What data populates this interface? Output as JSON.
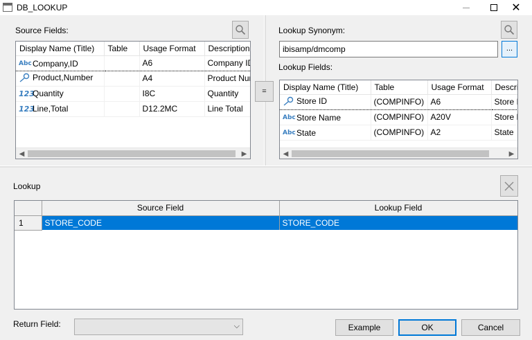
{
  "window": {
    "title": "DB_LOOKUP"
  },
  "source": {
    "label": "Source Fields:",
    "columns": [
      "Display Name (Title)",
      "Table",
      "Usage Format",
      "Description"
    ],
    "rows": [
      {
        "icon": "abc-icon",
        "name": "Company,ID",
        "table": "",
        "format": "A6",
        "desc": "Company ID"
      },
      {
        "icon": "key-icon",
        "name": "Product,Number",
        "table": "",
        "format": "A4",
        "desc": "Product Number"
      },
      {
        "icon": "num-icon",
        "name": "Quantity",
        "table": "",
        "format": "I8C",
        "desc": "Quantity"
      },
      {
        "icon": "num-icon",
        "name": "Line,Total",
        "table": "",
        "format": "D12.2MC",
        "desc": "Line Total"
      }
    ]
  },
  "equals_label": "=",
  "lookup_synonym": {
    "label": "Lookup Synonym:",
    "value": "ibisamp/dmcomp",
    "browse_label": "..."
  },
  "lookup_fields": {
    "label": "Lookup Fields:",
    "columns": [
      "Display Name (Title)",
      "Table",
      "Usage Format",
      "Description"
    ],
    "rows": [
      {
        "icon": "key-icon",
        "name": "Store ID",
        "table": "(COMPINFO)",
        "format": "A6",
        "desc": "Store ID"
      },
      {
        "icon": "abc-icon",
        "name": "Store Name",
        "table": "(COMPINFO)",
        "format": "A20V",
        "desc": "Store Name"
      },
      {
        "icon": "abc-icon",
        "name": "State",
        "table": "(COMPINFO)",
        "format": "A2",
        "desc": "State"
      }
    ]
  },
  "lookup": {
    "label": "Lookup",
    "columns": [
      "Source Field",
      "Lookup Field"
    ],
    "rows": [
      {
        "num": "1",
        "source": "STORE_CODE",
        "lookup": "STORE_CODE"
      }
    ]
  },
  "return_field": {
    "label": "Return Field:",
    "value": ""
  },
  "buttons": {
    "example": "Example",
    "ok": "OK",
    "cancel": "Cancel"
  },
  "icons": {
    "abc": "Abc",
    "num": "123"
  },
  "colors": {
    "accent": "#0078d7"
  }
}
